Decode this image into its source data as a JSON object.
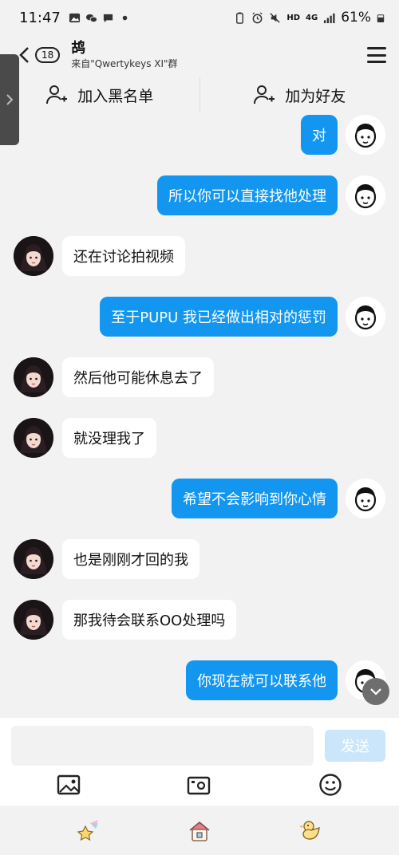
{
  "status_bar": {
    "time": "11:47",
    "net_hd": "HD",
    "net_4g": "4G",
    "battery": "61%"
  },
  "header": {
    "unread_count": "18",
    "title": "鸪",
    "subtitle": "来自\"Qwertykeys XI\"群"
  },
  "actions": {
    "blacklist": "加入黑名单",
    "add_friend": "加为好友"
  },
  "messages": [
    {
      "side": "out",
      "text": "对"
    },
    {
      "side": "out",
      "text": "所以你可以直接找他处理"
    },
    {
      "side": "in",
      "text": "还在讨论拍视频"
    },
    {
      "side": "out",
      "text": "至于PUPU 我已经做出相对的惩罚"
    },
    {
      "side": "in",
      "text": "然后他可能休息去了"
    },
    {
      "side": "in",
      "text": "就没理我了"
    },
    {
      "side": "out",
      "text": "希望不会影响到你心情"
    },
    {
      "side": "in",
      "text": "也是刚刚才回的我"
    },
    {
      "side": "in",
      "text": "那我待会联系OO处理吗"
    },
    {
      "side": "out",
      "text": "你现在就可以联系他"
    }
  ],
  "input": {
    "placeholder": "",
    "send_label": "发送"
  },
  "colors": {
    "outgoing_bubble": "#1296f0",
    "send_disabled": "#cbe6fb"
  }
}
